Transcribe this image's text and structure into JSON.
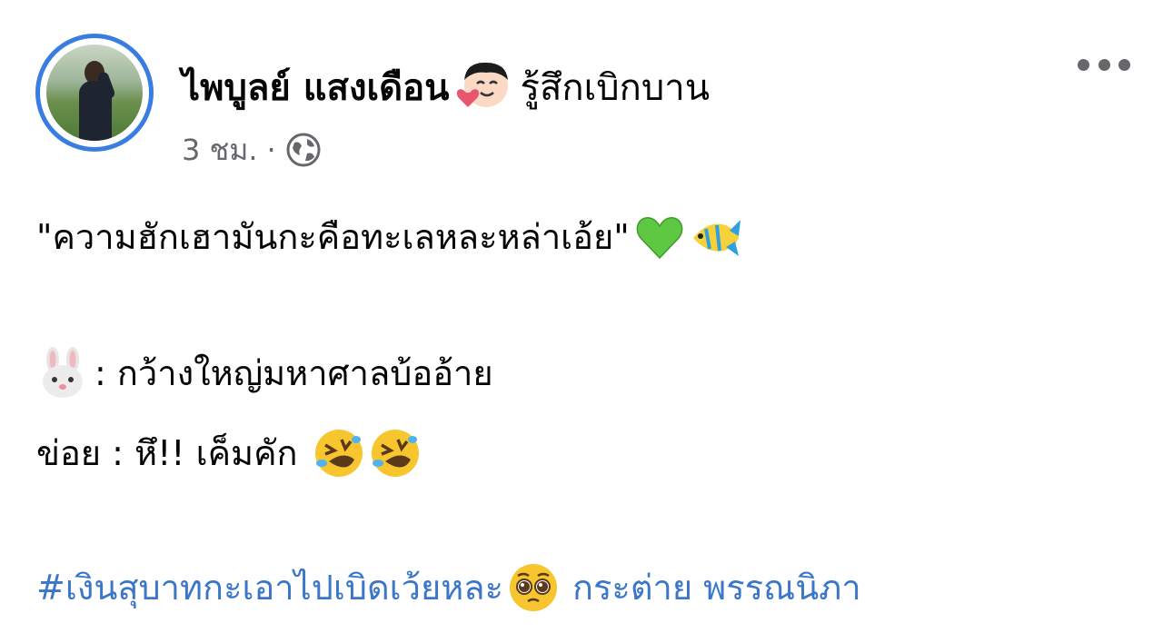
{
  "post": {
    "author": "ไพบูลย์ แสงเดือน",
    "feeling_icon": "face-with-heart-icon",
    "feeling_text": "รู้สึกเบิกบาน",
    "time": "3 ชม.",
    "separator": "·",
    "privacy_icon": "globe-icon",
    "lines": [
      {
        "text": "\"ความฮักเฮามันกะคือทะเลหละหล่าเอ้ย\"",
        "emojis": [
          "green-heart-icon",
          "tropical-fish-icon"
        ]
      },
      {
        "prefix_emoji": "rabbit-face-icon",
        "text": " : กว้างใหญ่มหาศาลบ้ออ้าย"
      },
      {
        "text": "ข่อย : หึ!! เค็มคัก ",
        "emojis": [
          "rolling-laughing-icon",
          "rolling-laughing-icon"
        ]
      }
    ],
    "hashtag": "#เงินสุบาทกะเอาไปเบิดเว้ยหละ",
    "hashtag_emoji": "pleading-face-icon",
    "mention": "กระต่าย พรรณนิภา"
  },
  "colors": {
    "link": "#3b76c8",
    "avatar_ring": "#3a7de0",
    "meta_text": "#65676b"
  }
}
